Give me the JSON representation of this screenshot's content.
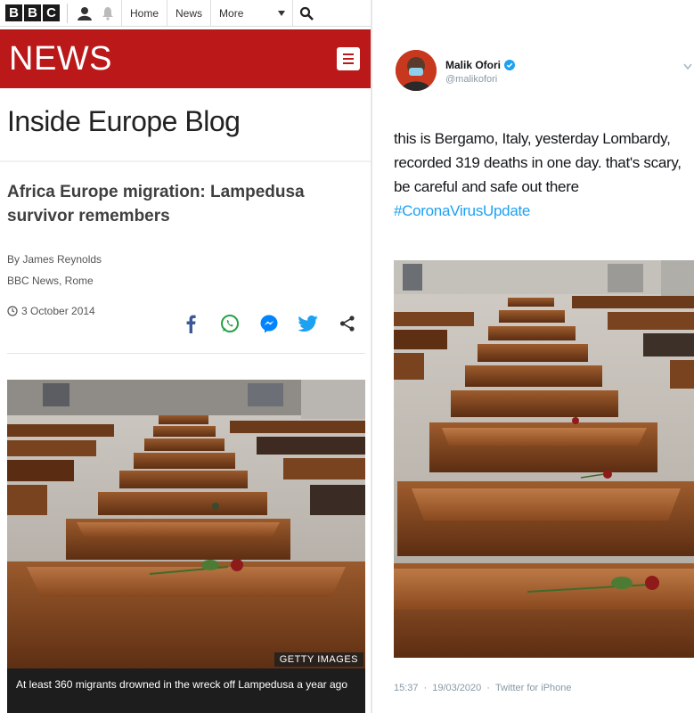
{
  "bbc": {
    "logo_letters": [
      "B",
      "B",
      "C"
    ],
    "nav": {
      "home": "Home",
      "news": "News",
      "more": "More"
    },
    "section_title": "NEWS",
    "blog_title": "Inside Europe Blog",
    "article": {
      "headline": "Africa Europe migration: Lampedusa survivor remembers",
      "author": "By James Reynolds",
      "outlet": "BBC News, Rome",
      "date": "3 October 2014"
    },
    "image": {
      "credit": "GETTY IMAGES",
      "caption": "At least 360 migrants drowned in the wreck off Lampedusa a year ago"
    },
    "colors": {
      "brand_red": "#bb1919"
    },
    "share_icons": [
      "facebook-icon",
      "whatsapp-icon",
      "messenger-icon",
      "twitter-icon",
      "share-icon"
    ]
  },
  "tweet": {
    "name": "Malik Ofori",
    "handle": "@malikofori",
    "text": "this is Bergamo, Italy, yesterday Lombardy, recorded 319 deaths in one day. that's scary, be careful and safe out there",
    "hashtag": "#CoronaVirusUpdate",
    "time": "15:37",
    "date": "19/03/2020",
    "source": "Twitter for iPhone",
    "colors": {
      "link_blue": "#1da1f2",
      "verified_blue": "#1da1f2"
    }
  }
}
